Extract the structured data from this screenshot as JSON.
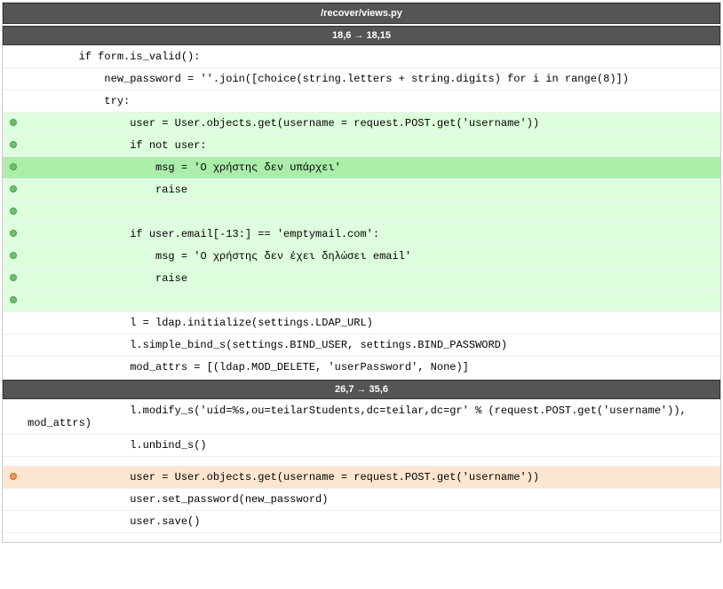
{
  "file_header": "/recover/views.py",
  "hunks": [
    {
      "label": "18,6 → 18,15",
      "lines": [
        {
          "type": "context",
          "text": "        if form.is_valid():"
        },
        {
          "type": "context",
          "text": "            new_password = ''.join([choice(string.letters + string.digits) for i in range(8)])"
        },
        {
          "type": "context",
          "text": "            try:"
        },
        {
          "type": "add",
          "text": "                user = User.objects.get(username = request.POST.get('username'))"
        },
        {
          "type": "add",
          "text": "                if not user:"
        },
        {
          "type": "add-hl",
          "text": "                    msg = 'Ο χρήστης δεν υπάρχει'"
        },
        {
          "type": "add",
          "text": "                    raise"
        },
        {
          "type": "add",
          "text": ""
        },
        {
          "type": "add",
          "text": "                if user.email[-13:] == 'emptymail.com':"
        },
        {
          "type": "add",
          "text": "                    msg = 'Ο χρήστης δεν έχει δηλώσει email'"
        },
        {
          "type": "add",
          "text": "                    raise"
        },
        {
          "type": "add",
          "text": ""
        },
        {
          "type": "context",
          "text": "                l = ldap.initialize(settings.LDAP_URL)"
        },
        {
          "type": "context",
          "text": "                l.simple_bind_s(settings.BIND_USER, settings.BIND_PASSWORD)"
        },
        {
          "type": "context",
          "text": "                mod_attrs = [(ldap.MOD_DELETE, 'userPassword', None)]"
        }
      ]
    },
    {
      "label": "26,7 → 35,6",
      "lines": [
        {
          "type": "context",
          "text": "                l.modify_s('uid=%s,ou=teilarStudents,dc=teilar,dc=gr' % (request.POST.get('username')), mod_attrs)"
        },
        {
          "type": "context",
          "text": "                l.unbind_s()"
        },
        {
          "type": "context",
          "text": ""
        },
        {
          "type": "del",
          "text": "                user = User.objects.get(username = request.POST.get('username'))"
        },
        {
          "type": "context",
          "text": "                user.set_password(new_password)"
        },
        {
          "type": "context",
          "text": "                user.save()"
        },
        {
          "type": "spacer",
          "text": ""
        }
      ]
    }
  ]
}
